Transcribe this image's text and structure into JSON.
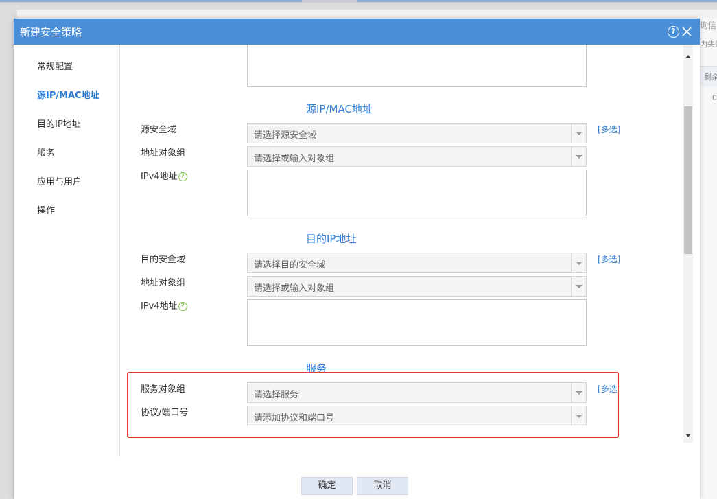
{
  "background": {
    "right_text_1": "询信",
    "right_text_2": "内失效",
    "right_header": "剩余",
    "right_value": "0"
  },
  "dialog": {
    "title": "新建安全策略",
    "help_icon": "?",
    "close_icon": "close-icon"
  },
  "sidenav": {
    "items": [
      {
        "label": "常规配置",
        "active": false
      },
      {
        "label": "源IP/MAC地址",
        "active": true
      },
      {
        "label": "目的IP地址",
        "active": false
      },
      {
        "label": "服务",
        "active": false
      },
      {
        "label": "应用与用户",
        "active": false
      },
      {
        "label": "操作",
        "active": false
      }
    ]
  },
  "source_section": {
    "title": "源IP/MAC地址",
    "zone_label": "源安全域",
    "zone_placeholder": "请选择源安全域",
    "multi_link": "[多选]",
    "addr_group_label": "地址对象组",
    "addr_group_placeholder": "请选择或输入对象组",
    "ipv4_label": "IPv4地址"
  },
  "dest_section": {
    "title": "目的IP地址",
    "zone_label": "目的安全域",
    "zone_placeholder": "请选择目的安全域",
    "multi_link": "[多选]",
    "addr_group_label": "地址对象组",
    "addr_group_placeholder": "请选择或输入对象组",
    "ipv4_label": "IPv4地址"
  },
  "service_section": {
    "title": "服务",
    "service_group_label": "服务对象组",
    "service_group_placeholder": "请选择服务",
    "multi_link": "[多选",
    "protocol_label": "协议/端口号",
    "protocol_placeholder": "请添加协议和端口号"
  },
  "footer": {
    "ok_label": "确定",
    "cancel_label": "取消"
  },
  "colors": {
    "header": "#4a90d9",
    "accent": "#2f7ed8",
    "highlight": "#e53935",
    "help_green": "#7cc14a"
  }
}
